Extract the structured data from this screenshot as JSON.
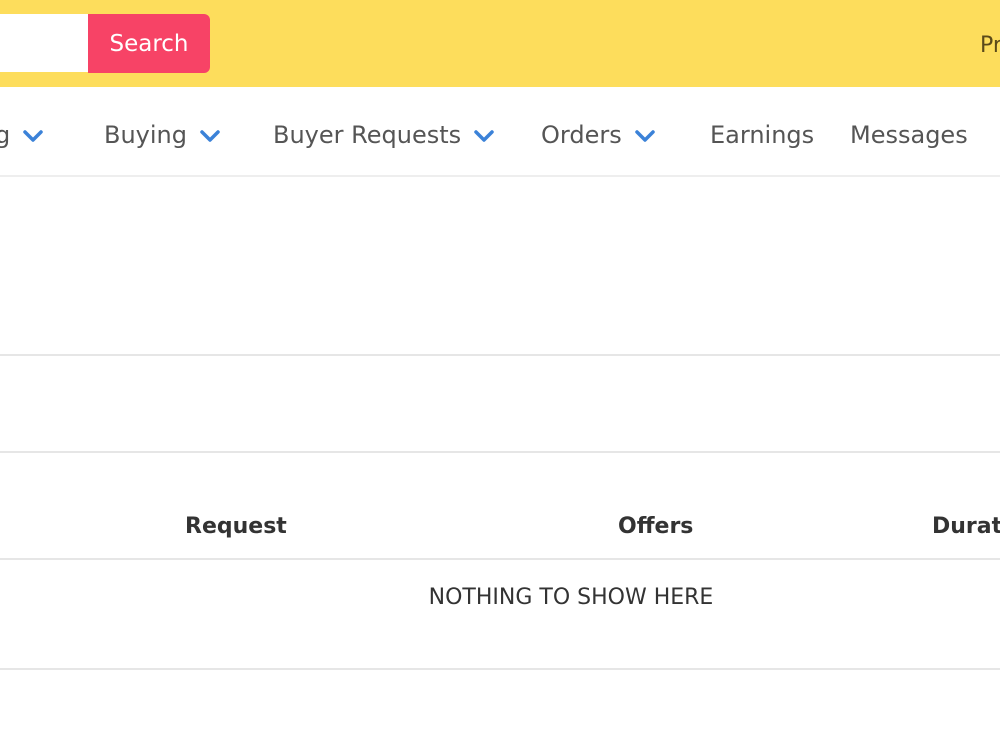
{
  "header": {
    "search": {
      "value": "",
      "placeholder": "",
      "button_label": "Search"
    },
    "right_link": "Pr"
  },
  "nav": {
    "items": [
      {
        "label": "g",
        "has_dropdown": true
      },
      {
        "label": "Buying",
        "has_dropdown": true
      },
      {
        "label": "Buyer Requests",
        "has_dropdown": true
      },
      {
        "label": "Orders",
        "has_dropdown": true
      },
      {
        "label": "Earnings",
        "has_dropdown": false
      },
      {
        "label": "Messages",
        "has_dropdown": false
      }
    ],
    "chevron_color": "#3b82d8"
  },
  "table": {
    "columns": [
      "Request",
      "Offers",
      "Durat"
    ],
    "empty_message": "NOTHING TO SHOW HERE"
  },
  "colors": {
    "header_bg": "#fddd5c",
    "search_button_bg": "#f74366"
  }
}
